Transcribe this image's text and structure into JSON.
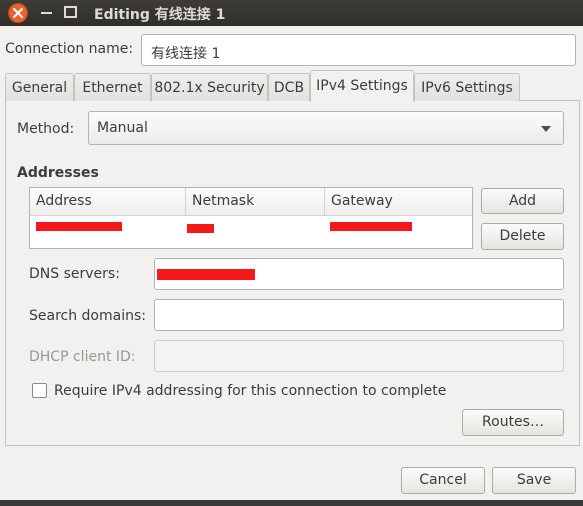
{
  "window": {
    "title": "Editing 有线连接 1"
  },
  "connection": {
    "label": "Connection name:",
    "value": "有线连接 1"
  },
  "tabs": [
    {
      "label": "General"
    },
    {
      "label": "Ethernet"
    },
    {
      "label": "802.1x Security"
    },
    {
      "label": "DCB"
    },
    {
      "label": "IPv4 Settings",
      "active": true
    },
    {
      "label": "IPv6 Settings"
    }
  ],
  "ipv4": {
    "method_label": "Method:",
    "method_value": "Manual",
    "addresses_heading": "Addresses",
    "columns": [
      "Address",
      "Netmask",
      "Gateway"
    ],
    "add_label": "Add",
    "delete_label": "Delete",
    "dns_label": "DNS servers:",
    "search_label": "Search domains:",
    "search_value": "",
    "dhcp_label": "DHCP client ID:",
    "dhcp_value": "",
    "require_label": "Require IPv4 addressing for this connection to complete",
    "require_checked": false,
    "routes_label": "Routes…"
  },
  "footer": {
    "cancel_label": "Cancel",
    "save_label": "Save"
  },
  "colors": {
    "close": "#e9622e",
    "titlebar": "#3d3c38",
    "redaction": "#f5191c"
  }
}
